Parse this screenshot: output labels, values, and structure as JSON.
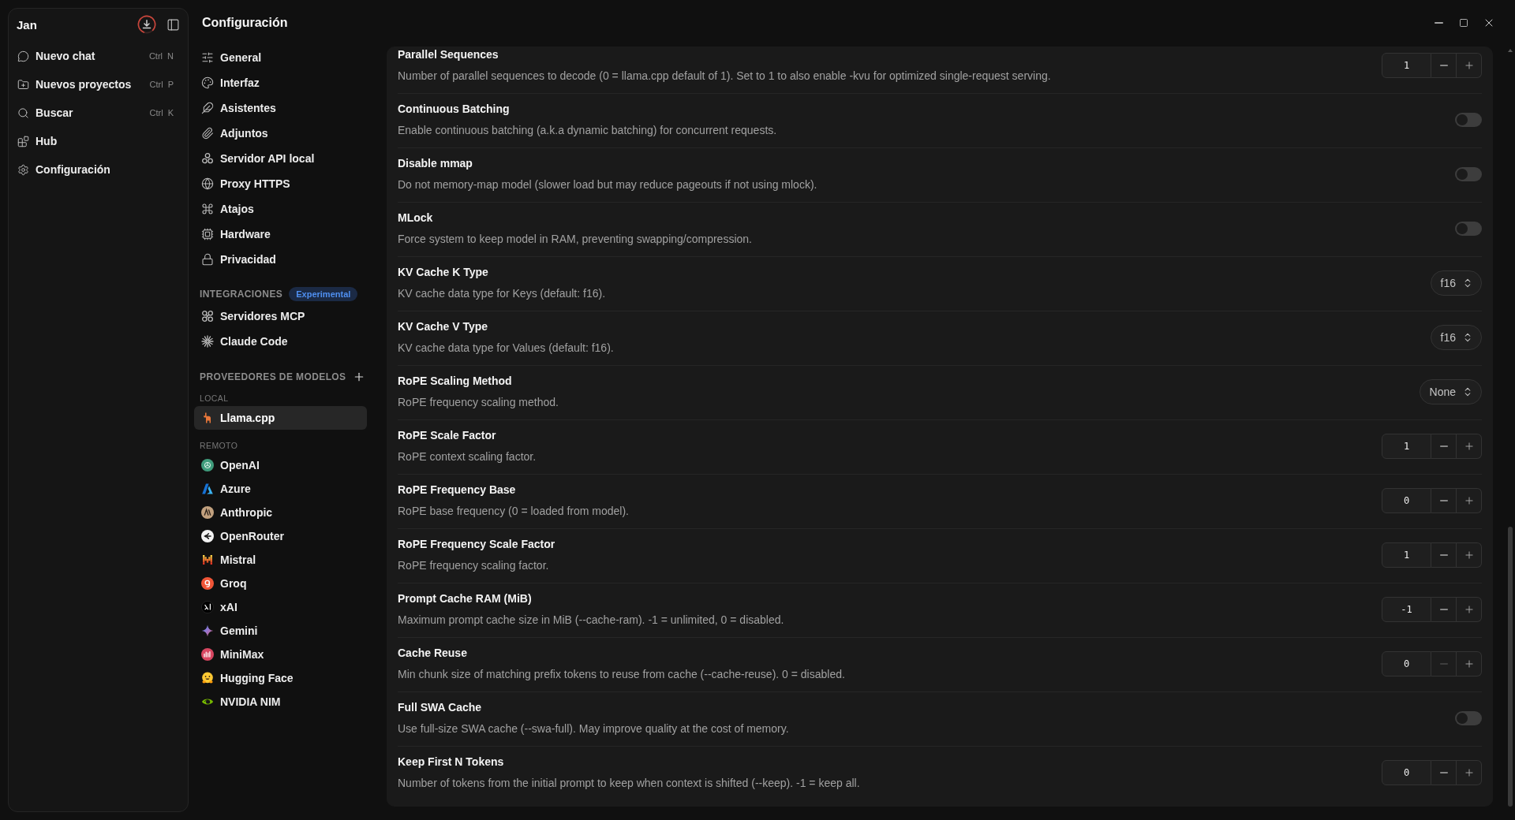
{
  "app_sidebar": {
    "title": "Jan",
    "items": [
      {
        "label": "Nuevo chat",
        "shortcut": "Ctrl N",
        "selected": false
      },
      {
        "label": "Nuevos proyectos",
        "shortcut": "Ctrl P",
        "selected": false
      },
      {
        "label": "Buscar",
        "shortcut": "Ctrl K",
        "selected": false
      },
      {
        "label": "Hub",
        "selected": false
      },
      {
        "label": "Configuración",
        "selected": false
      }
    ]
  },
  "settings": {
    "title": "Configuración",
    "nav": [
      {
        "label": "General",
        "selected": false
      },
      {
        "label": "Interfaz",
        "selected": false
      },
      {
        "label": "Asistentes",
        "selected": false
      },
      {
        "label": "Adjuntos",
        "selected": false
      },
      {
        "label": "Servidor API local",
        "selected": false
      },
      {
        "label": "Proxy HTTPS",
        "selected": false
      },
      {
        "label": "Atajos",
        "selected": false
      },
      {
        "label": "Hardware",
        "selected": false
      },
      {
        "label": "Privacidad",
        "selected": false
      }
    ],
    "integrations": {
      "heading": "INTEGRACIONES",
      "badge": "Experimental",
      "items": [
        {
          "label": "Servidores MCP",
          "selected": false
        },
        {
          "label": "Claude Code",
          "selected": false
        }
      ]
    },
    "providers": {
      "heading": "PROVEEDORES DE MODELOS",
      "groups": [
        {
          "heading": "LOCAL",
          "items": [
            {
              "label": "Llama.cpp",
              "selected": true
            }
          ]
        },
        {
          "heading": "REMOTO",
          "items": [
            {
              "label": "OpenAI",
              "selected": false
            },
            {
              "label": "Azure",
              "selected": false
            },
            {
              "label": "Anthropic",
              "selected": false
            },
            {
              "label": "OpenRouter",
              "selected": false
            },
            {
              "label": "Mistral",
              "selected": false
            },
            {
              "label": "Groq",
              "selected": false
            },
            {
              "label": "xAI",
              "selected": false
            },
            {
              "label": "Gemini",
              "selected": false
            },
            {
              "label": "MiniMax",
              "selected": false
            },
            {
              "label": "Hugging Face",
              "selected": false
            },
            {
              "label": "NVIDIA NIM",
              "selected": false
            }
          ]
        }
      ]
    }
  },
  "settings_list": [
    {
      "kind": "stepper",
      "title": "Parallel Sequences",
      "description": "Number of parallel sequences to decode (0 = llama.cpp default of 1). Set to 1 to also enable -kvu for optimized single-request serving.",
      "value": "1",
      "decrement_disabled": false
    },
    {
      "kind": "toggle",
      "title": "Continuous Batching",
      "description": "Enable continuous batching (a.k.a dynamic batching) for concurrent requests.",
      "on": false
    },
    {
      "kind": "toggle",
      "title": "Disable mmap",
      "description": "Do not memory-map model (slower load but may reduce pageouts if not using mlock).",
      "on": false
    },
    {
      "kind": "toggle",
      "title": "MLock",
      "description": "Force system to keep model in RAM, preventing swapping/compression.",
      "on": false
    },
    {
      "kind": "select",
      "title": "KV Cache K Type",
      "description": "KV cache data type for Keys (default: f16).",
      "value": "f16"
    },
    {
      "kind": "select",
      "title": "KV Cache V Type",
      "description": "KV cache data type for Values (default: f16).",
      "value": "f16"
    },
    {
      "kind": "select",
      "title": "RoPE Scaling Method",
      "description": "RoPE frequency scaling method.",
      "value": "None"
    },
    {
      "kind": "stepper",
      "title": "RoPE Scale Factor",
      "description": "RoPE context scaling factor.",
      "value": "1",
      "decrement_disabled": false
    },
    {
      "kind": "stepper",
      "title": "RoPE Frequency Base",
      "description": "RoPE base frequency (0 = loaded from model).",
      "value": "0",
      "decrement_disabled": false
    },
    {
      "kind": "stepper",
      "title": "RoPE Frequency Scale Factor",
      "description": "RoPE frequency scaling factor.",
      "value": "1",
      "decrement_disabled": false
    },
    {
      "kind": "stepper",
      "title": "Prompt Cache RAM (MiB)",
      "description": "Maximum prompt cache size in MiB (--cache-ram). -1 = unlimited, 0 = disabled.",
      "value": "-1",
      "decrement_disabled": false
    },
    {
      "kind": "stepper",
      "title": "Cache Reuse",
      "description": "Min chunk size of matching prefix tokens to reuse from cache (--cache-reuse). 0 = disabled.",
      "value": "0",
      "decrement_disabled": true
    },
    {
      "kind": "toggle",
      "title": "Full SWA Cache",
      "description": "Use full-size SWA cache (--swa-full). May improve quality at the cost of memory.",
      "on": false
    },
    {
      "kind": "stepper",
      "title": "Keep First N Tokens",
      "description": "Number of tokens from the initial prompt to keep when context is shifted (--keep). -1 = keep all.",
      "value": "0",
      "decrement_disabled": false
    }
  ]
}
